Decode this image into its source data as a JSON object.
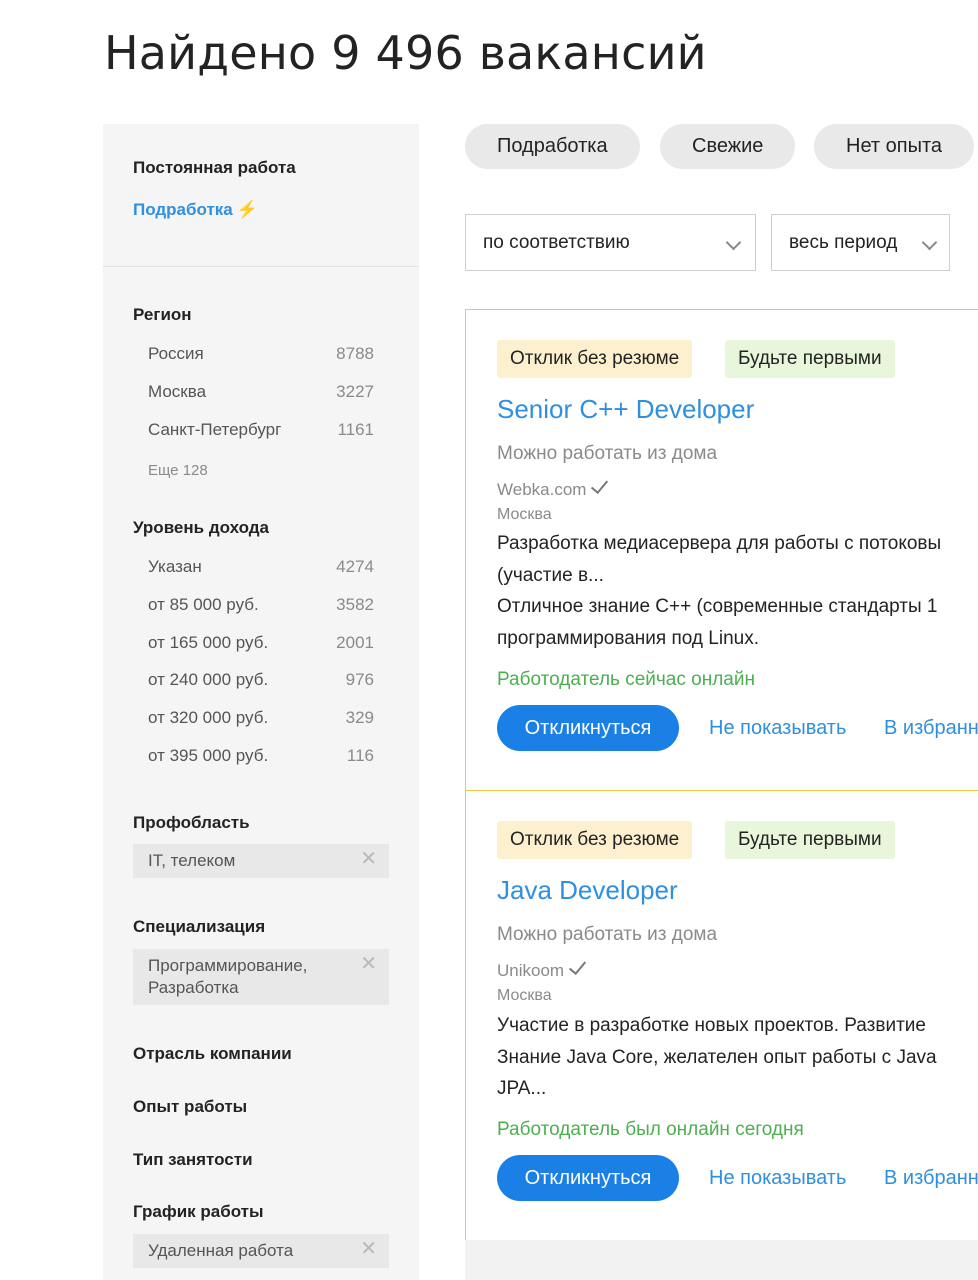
{
  "header": {
    "title": "Найдено 9 496 вакансий"
  },
  "sidebar": {
    "employment_type": "Постоянная работа",
    "parttime_link": "Подработка",
    "parttime_icon": "lightning-icon",
    "region": {
      "heading": "Регион",
      "items": [
        {
          "label": "Россия",
          "count": "8788"
        },
        {
          "label": "Москва",
          "count": "3227"
        },
        {
          "label": "Санкт-Петербург",
          "count": "1161"
        }
      ],
      "more": "Еще 128"
    },
    "income": {
      "heading": "Уровень дохода",
      "items": [
        {
          "label": "Указан",
          "count": "4274"
        },
        {
          "label": "от 85 000 руб.",
          "count": "3582"
        },
        {
          "label": "от 165 000 руб.",
          "count": "2001"
        },
        {
          "label": "от 240 000 руб.",
          "count": "976"
        },
        {
          "label": "от 320 000 руб.",
          "count": "329"
        },
        {
          "label": "от 395 000 руб.",
          "count": "116"
        }
      ]
    },
    "profarea": {
      "heading": "Профобласть",
      "chip": "IT, телеком"
    },
    "specialization": {
      "heading": "Специализация",
      "chip": "Программирование, Разработка"
    },
    "industry": {
      "heading": "Отрасль компании"
    },
    "experience": {
      "heading": "Опыт работы"
    },
    "employment": {
      "heading": "Тип занятости"
    },
    "schedule": {
      "heading": "График работы",
      "chip": "Удаленная работа"
    }
  },
  "quick_filters": [
    "Подработка",
    "Свежие",
    "Нет опыта"
  ],
  "sort": {
    "order": "по соответствию",
    "period": "весь период"
  },
  "vacancies": [
    {
      "tag1": "Отклик без резюме",
      "tag2": "Будьте первыми",
      "title": "Senior C++ Developer",
      "remote": "Можно работать из дома",
      "company": "Webka.com",
      "city": "Москва",
      "lines": [
        "Разработка медиасервера для работы с потоковы",
        "(участие в...",
        "Отличное знание C++ (современные стандарты 1",
        "программирования под Linux."
      ],
      "online": "Работодатель сейчас онлайн",
      "apply": "Откликнуться",
      "hide": "Не показывать",
      "favorite": "В избранн"
    },
    {
      "tag1": "Отклик без резюме",
      "tag2": "Будьте первыми",
      "title": "Java Developer",
      "remote": "Можно работать из дома",
      "company": "Unikoom",
      "city": "Москва",
      "lines": [
        "Участие в разработке новых проектов. Развитие",
        "Знание Java Core, желателен опыт работы с Java",
        "JPA..."
      ],
      "online": "Работодатель был онлайн сегодня",
      "apply": "Откликнуться",
      "hide": "Не показывать",
      "favorite": "В избранн"
    }
  ],
  "colors": {
    "accent": "#2f8fe0",
    "apply_button": "#1a80e5",
    "online": "#4caf50",
    "card_border": "#f0c93c",
    "tag_noresume": "#fdf0cf",
    "tag_first": "#e8f7dc"
  }
}
